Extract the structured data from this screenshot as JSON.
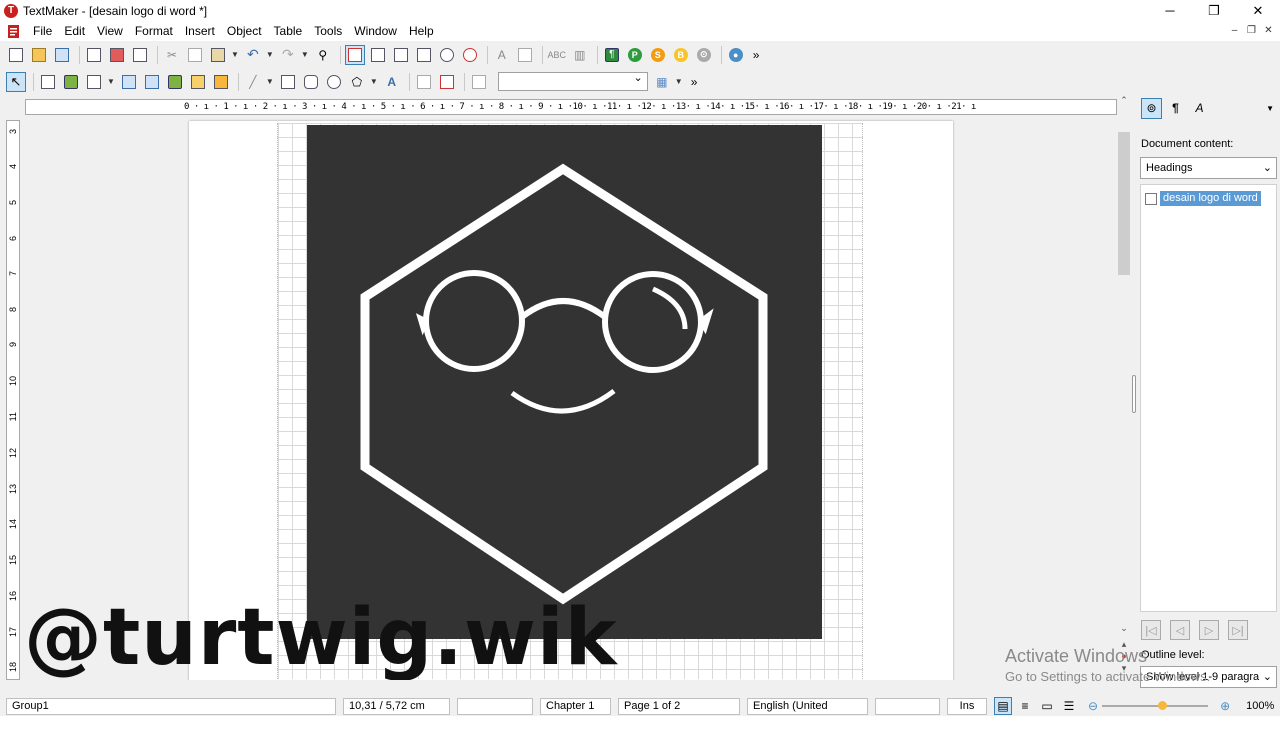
{
  "window": {
    "title": "TextMaker - [desain logo di word *]",
    "minimize": "─",
    "restore": "❐",
    "close": "✕"
  },
  "menu": [
    "File",
    "Edit",
    "View",
    "Format",
    "Insert",
    "Object",
    "Table",
    "Tools",
    "Window",
    "Help"
  ],
  "toolbar": {
    "more": "»",
    "style_value": ""
  },
  "ruler": {
    "horizontal": "0 · ı · 1 · ı · 2 · ı · 3 · ı · 4 · ı · 5 · ı · 6 · ı · 7 · ı · 8 · ı · 9 · ı ·10· ı ·11· ı ·12· ı ·13· ı ·14· ı ·15· ı ·16· ı ·17· ı ·18· ı ·19· ı ·20· ı ·21· ı",
    "vertical": [
      "3",
      "4",
      "5",
      "6",
      "7",
      "8",
      "9",
      "10",
      "11",
      "12",
      "13",
      "14",
      "15",
      "16",
      "17",
      "18"
    ]
  },
  "watermark": "@turtwig.wik",
  "sidebar": {
    "content_label": "Document content:",
    "content_value": "Headings",
    "items": [
      {
        "label": "desain logo di word",
        "checked": false
      }
    ],
    "outline_label": "Outline level:",
    "outline_value": "Show level 1-9 paragra"
  },
  "activation": {
    "line1": "Activate Windows",
    "line2": "Go to Settings to activate Windows."
  },
  "status": {
    "object": "Group1",
    "position": "10,31 / 5,72 cm",
    "field3": "",
    "chapter": "Chapter 1",
    "page": "Page 1 of 2",
    "language": "English (United",
    "field7": "",
    "mode": "Ins",
    "zoom": "100%"
  },
  "colors": {
    "logo_bg": "#333333",
    "logo_stroke": "#ffffff",
    "accent": "#3c7fb1"
  }
}
